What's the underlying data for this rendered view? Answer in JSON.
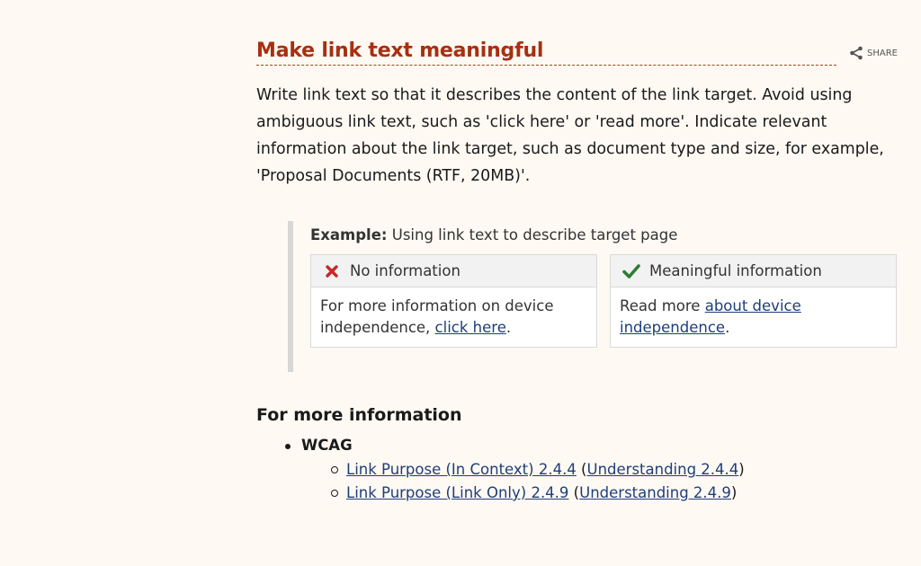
{
  "section": {
    "title": "Make link text meaningful",
    "share_label": "SHARE",
    "intro": "Write link text so that it describes the content of the link target. Avoid using ambiguous link text, such as 'click here' or 'read more'. Indicate relevant information about the link target, such as document type and size, for example, 'Proposal Documents (RTF, 20MB)'."
  },
  "example": {
    "caption_bold": "Example:",
    "caption_text": " Using link text to describe target page",
    "bad": {
      "heading": "No information",
      "icon": "cross-icon",
      "text_before": "For more information on device independence, ",
      "link": "click here",
      "text_after": "."
    },
    "good": {
      "heading": "Meaningful information",
      "icon": "check-icon",
      "text_before": "Read more ",
      "link": "about device independence",
      "text_after": "."
    },
    "colors": {
      "bad_icon": "#c62828",
      "good_icon": "#2e7d32"
    }
  },
  "more_info": {
    "title": "For more information",
    "group": "WCAG",
    "items": [
      {
        "link": "Link Purpose (In Context) 2.4.4",
        "paren_open": " (",
        "understanding": "Understanding 2.4.4",
        "paren_close": ")"
      },
      {
        "link": "Link Purpose (Link Only) 2.4.9",
        "paren_open": " (",
        "understanding": "Understanding 2.4.9",
        "paren_close": ")"
      }
    ]
  },
  "theme": {
    "background": "#fef9f3",
    "heading_color": "#a82f0f",
    "link_color": "#1d3e7a"
  }
}
